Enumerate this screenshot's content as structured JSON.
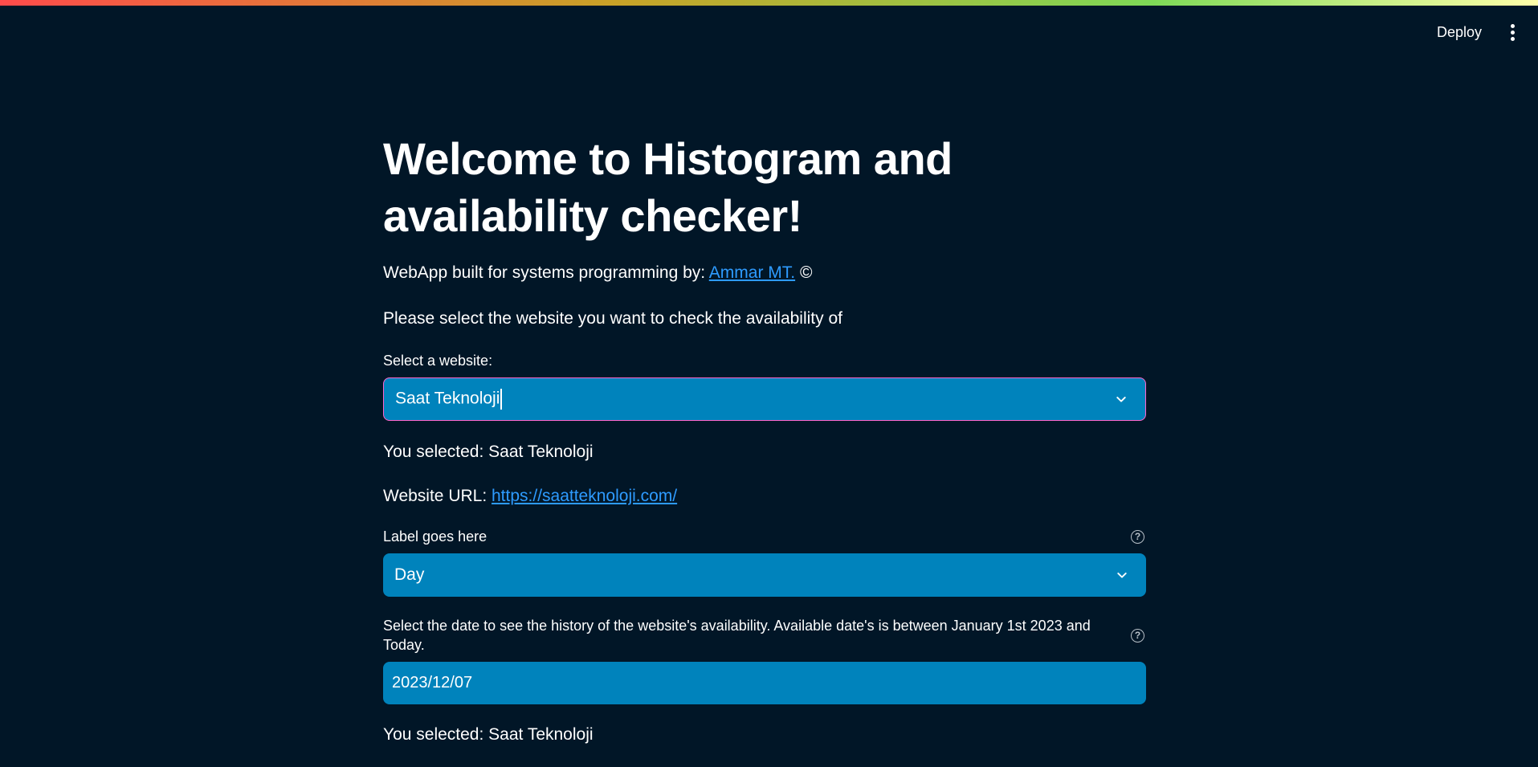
{
  "header": {
    "deploy_label": "Deploy",
    "menu_icon": "vertical-ellipsis-icon"
  },
  "main": {
    "title": "Welcome to Histogram and availability checker!",
    "byline_prefix": "WebApp built for systems programming by: ",
    "byline_link": "Ammar MT.",
    "byline_suffix": " ©",
    "instructions": "Please select the website you want to check the availability of",
    "website_select": {
      "label": "Select a website:",
      "value": "Saat Teknoloji"
    },
    "selected_text": "You selected: Saat Teknoloji",
    "url_prefix": "Website URL: ",
    "url_link": "https://saatteknoloji.com/",
    "period_select": {
      "label": "Label goes here",
      "value": "Day"
    },
    "date_input": {
      "label": "Select the date to see the history of the website's availability. Available date's is between January 1st 2023 and Today.",
      "value": "2023/12/07"
    },
    "selected_text_2": "You selected: Saat Teknoloji"
  },
  "colors": {
    "background": "#011627",
    "input_bg": "#0083bc",
    "link": "#2e9bff",
    "focus_border": "#ff66cc"
  }
}
